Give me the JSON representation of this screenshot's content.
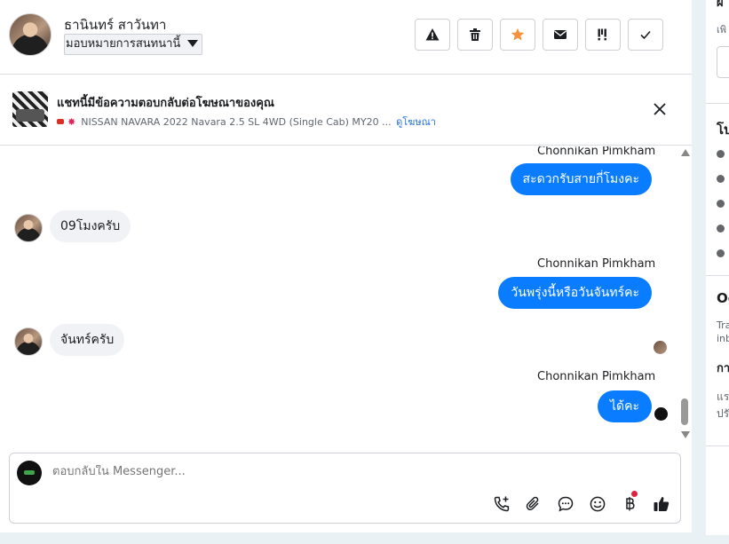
{
  "header": {
    "user_name": "ธานินทร์ สาวันทา",
    "assign_label": "มอบหมายการสนทนานี้",
    "tools": [
      {
        "name": "report-spam",
        "icon": "warning-icon"
      },
      {
        "name": "delete",
        "icon": "trash-icon"
      },
      {
        "name": "star",
        "icon": "star-icon",
        "color": "#f7923b"
      },
      {
        "name": "mark-unread",
        "icon": "envelope-icon"
      },
      {
        "name": "follow-up",
        "icon": "follow-up-icon"
      },
      {
        "name": "mark-done",
        "icon": "check-icon"
      }
    ]
  },
  "ad": {
    "title": "แชทนี้มีข้อความตอบกลับต่อโฆษณาของคุณ",
    "subtitle": "NISSAN NAVARA 2022 Navara 2.5 SL 4WD (Single Cab) MY20 ...",
    "link": "ดูโฆษณา"
  },
  "messages": [
    {
      "direction": "out",
      "sender": "Chonnikan Pimkham",
      "text": "สะดวกรับสายกี่โมงคะ"
    },
    {
      "direction": "in",
      "text": "09โมงครับ"
    },
    {
      "direction": "out",
      "sender": "Chonnikan Pimkham",
      "text": "วันพรุ่งนี้หรือวันจันทร์คะ"
    },
    {
      "direction": "in",
      "text": "จันทร์ครับ"
    },
    {
      "direction": "out",
      "sender": "Chonnikan Pimkham",
      "text": "ได้คะ"
    }
  ],
  "composer": {
    "placeholder": "ตอบกลับใน Messenger...",
    "icons": [
      "phone-add-icon",
      "paperclip-icon",
      "saved-reply-icon",
      "emoji-icon",
      "baht-icon",
      "thumbs-up-icon"
    ]
  },
  "right_panel": {
    "partial_1": "เพิ",
    "partial_2": "โป",
    "partial_3": "Oc",
    "partial_4": "Tra",
    "partial_5": "inb",
    "partial_6": "กา",
    "partial_7": "แร",
    "partial_8": "ปรั"
  },
  "colors": {
    "accent": "#0a7cff",
    "star": "#f7923b",
    "link": "#216fdb"
  }
}
